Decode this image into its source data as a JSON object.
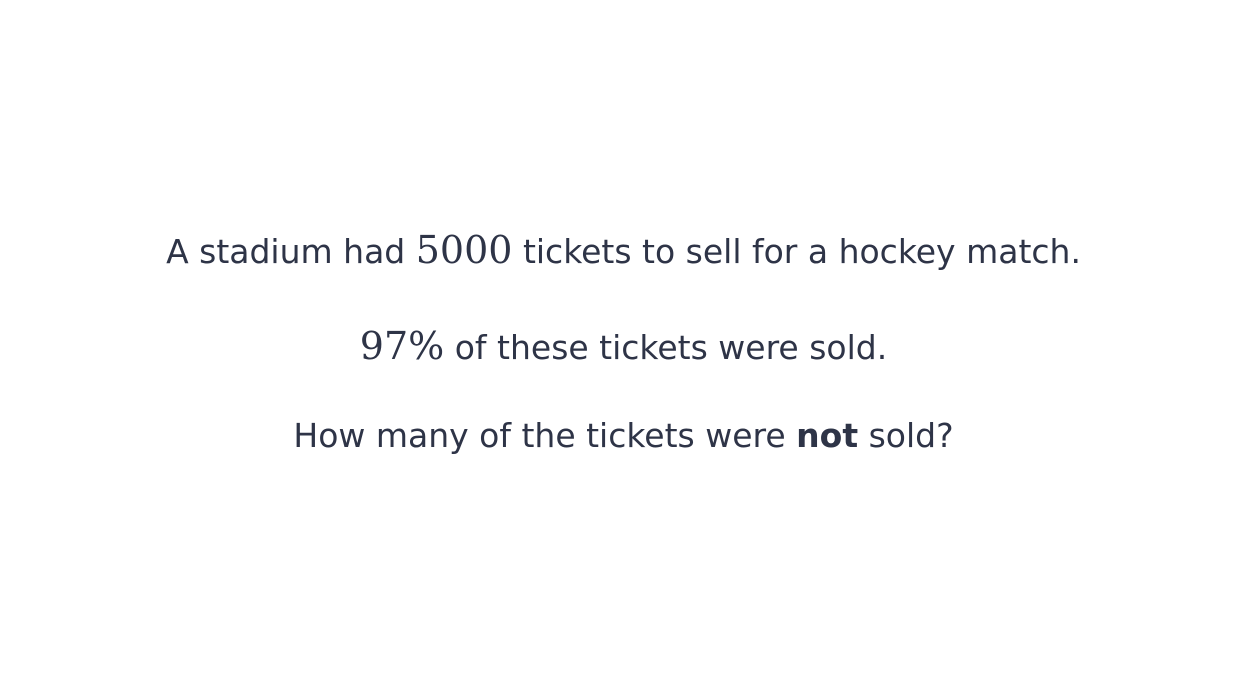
{
  "question": {
    "line1": {
      "before": "A stadium had ",
      "number": "5000",
      "after": " tickets to sell for a hockey match."
    },
    "line2": {
      "number": "97%",
      "after": " of these tickets were sold."
    },
    "line3": {
      "before": "How many of the tickets were ",
      "emphasis": "not",
      "after": " sold?"
    }
  },
  "colors": {
    "text": "#2e3447",
    "background": "#ffffff"
  }
}
